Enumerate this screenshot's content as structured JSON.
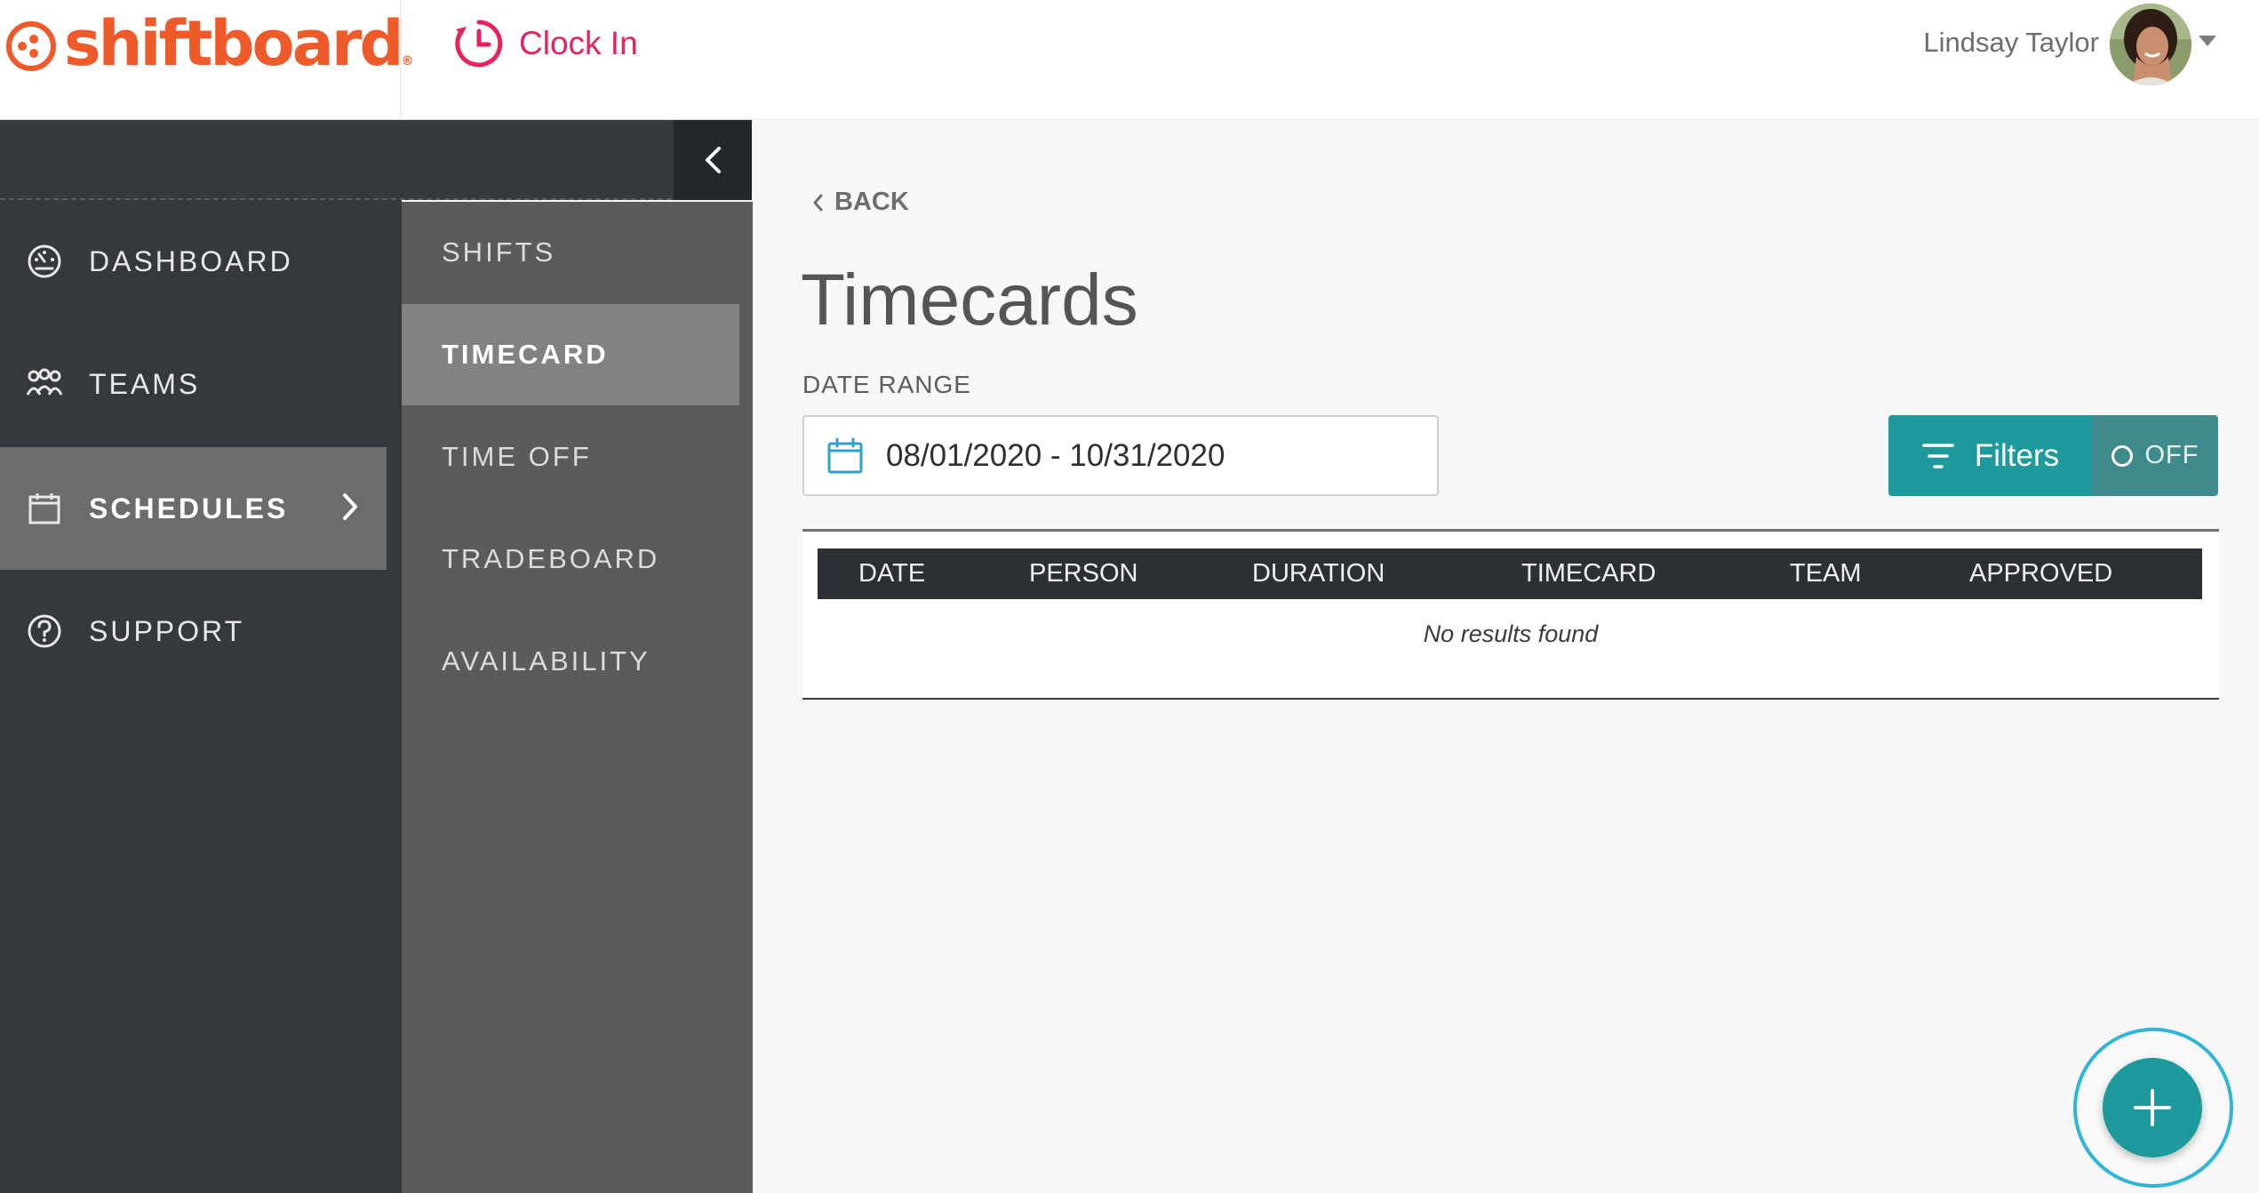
{
  "header": {
    "brand_name": "shiftboard",
    "brand_reg": "®",
    "brand_icon": "shiftboard-logo-icon",
    "clock_in_label": "Clock In",
    "clock_in_icon": "clock-icon",
    "user_name": "Lindsay Taylor",
    "avatar_icon": "avatar",
    "brand_color": "#ef5a2a",
    "clock_in_color": "#e6225c"
  },
  "sidebar": {
    "collapse_icon": "chevron-left-icon",
    "items": [
      {
        "label": "DASHBOARD",
        "icon": "gauge-icon",
        "active": false
      },
      {
        "label": "TEAMS",
        "icon": "people-icon",
        "active": false
      },
      {
        "label": "SCHEDULES",
        "icon": "calendar-icon",
        "active": true
      },
      {
        "label": "SUPPORT",
        "icon": "question-circle-icon",
        "active": false
      }
    ]
  },
  "subnav": {
    "items": [
      {
        "label": "SHIFTS",
        "active": false
      },
      {
        "label": "TIMECARD",
        "active": true
      },
      {
        "label": "TIME OFF",
        "active": false
      },
      {
        "label": "TRADEBOARD",
        "active": false
      },
      {
        "label": "AVAILABILITY",
        "active": false
      }
    ]
  },
  "main": {
    "back_label": "BACK",
    "title": "Timecards",
    "date_range_label": "DATE RANGE",
    "date_range_value": "08/01/2020 - 10/31/2020",
    "filters_label": "Filters",
    "filters_state": "OFF",
    "accent_color": "#1f9a9c",
    "table": {
      "columns": [
        "DATE",
        "PERSON",
        "DURATION",
        "TIMECARD",
        "TEAM",
        "APPROVED"
      ],
      "empty_message": "No results found"
    }
  },
  "fab": {
    "icon": "plus-icon"
  }
}
